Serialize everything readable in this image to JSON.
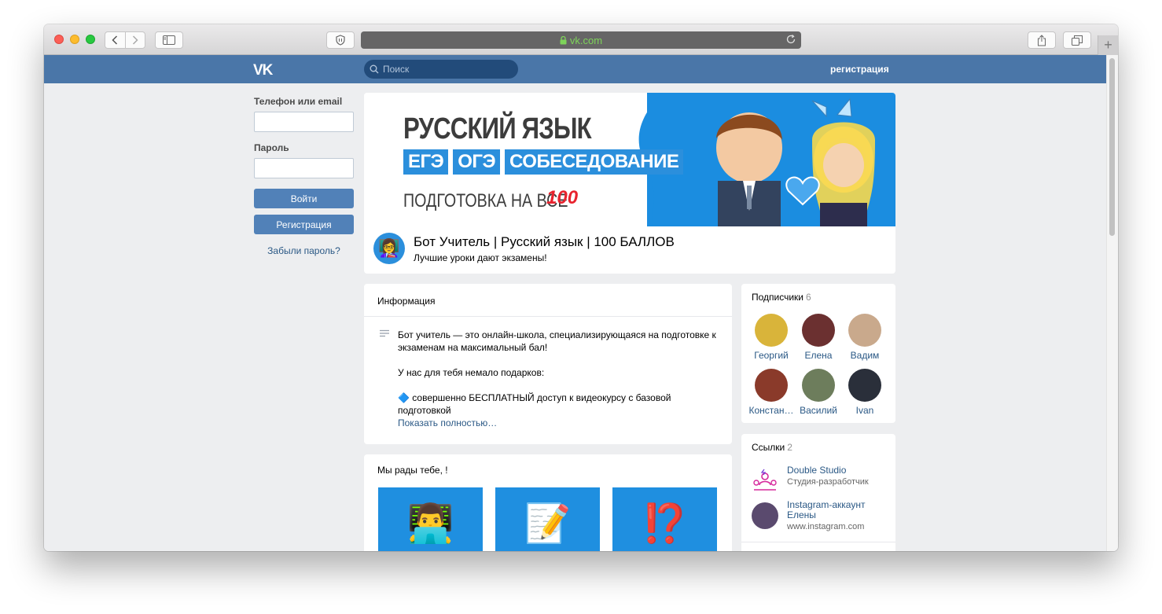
{
  "browser": {
    "url": "vk.com",
    "new_tab_symbol": "+"
  },
  "header": {
    "logo": "VK",
    "search_placeholder": "Поиск",
    "register_link": "регистрация"
  },
  "login": {
    "phone_label": "Телефон или email",
    "password_label": "Пароль",
    "login_button": "Войти",
    "register_button": "Регистрация",
    "forgot_link": "Забыли пароль?"
  },
  "cover": {
    "title": "РУССКИЙ ЯЗЫК",
    "tags": [
      "ЕГЭ",
      "ОГЭ",
      "СОБЕСЕДОВАНИЕ"
    ],
    "subtitle": "ПОДГОТОВКА НА ВСЕ",
    "score": "100"
  },
  "group": {
    "name": "Бот Учитель | Русский язык | 100 БАЛЛОВ",
    "status": "Лучшие уроки дают экзамены!"
  },
  "info": {
    "heading": "Информация",
    "paragraph1": "Бот учитель — это онлайн-школа, специализирующаяся на подготовке к экзаменам на максимальный бал!",
    "paragraph2": "У нас для тебя немало подарков:",
    "paragraph3": "🔷 совершенно БЕСПЛАТНЫЙ доступ к видеокурсу с базовой подготовкой",
    "show_more": "Показать полностью…"
  },
  "welcome": {
    "heading": "Мы рады тебе, !",
    "tiles": [
      "👨‍💻",
      "📝",
      "⁉️"
    ]
  },
  "subscribers": {
    "heading": "Подписчики",
    "count": "6",
    "items": [
      {
        "name": "Георгий",
        "color": "#d9b43a"
      },
      {
        "name": "Елена",
        "color": "#6b3030"
      },
      {
        "name": "Вадим",
        "color": "#c9a98c"
      },
      {
        "name": "Констан…",
        "color": "#8a3a2a"
      },
      {
        "name": "Василий",
        "color": "#6d7d5c"
      },
      {
        "name": "Ivan",
        "color": "#2a2f3a"
      }
    ]
  },
  "links": {
    "heading": "Ссылки",
    "count": "2",
    "items": [
      {
        "title": "Double Studio",
        "desc": "Студия-разработчик"
      },
      {
        "title": "Instagram-аккаунт Елены",
        "desc": "www.instagram.com"
      }
    ]
  }
}
